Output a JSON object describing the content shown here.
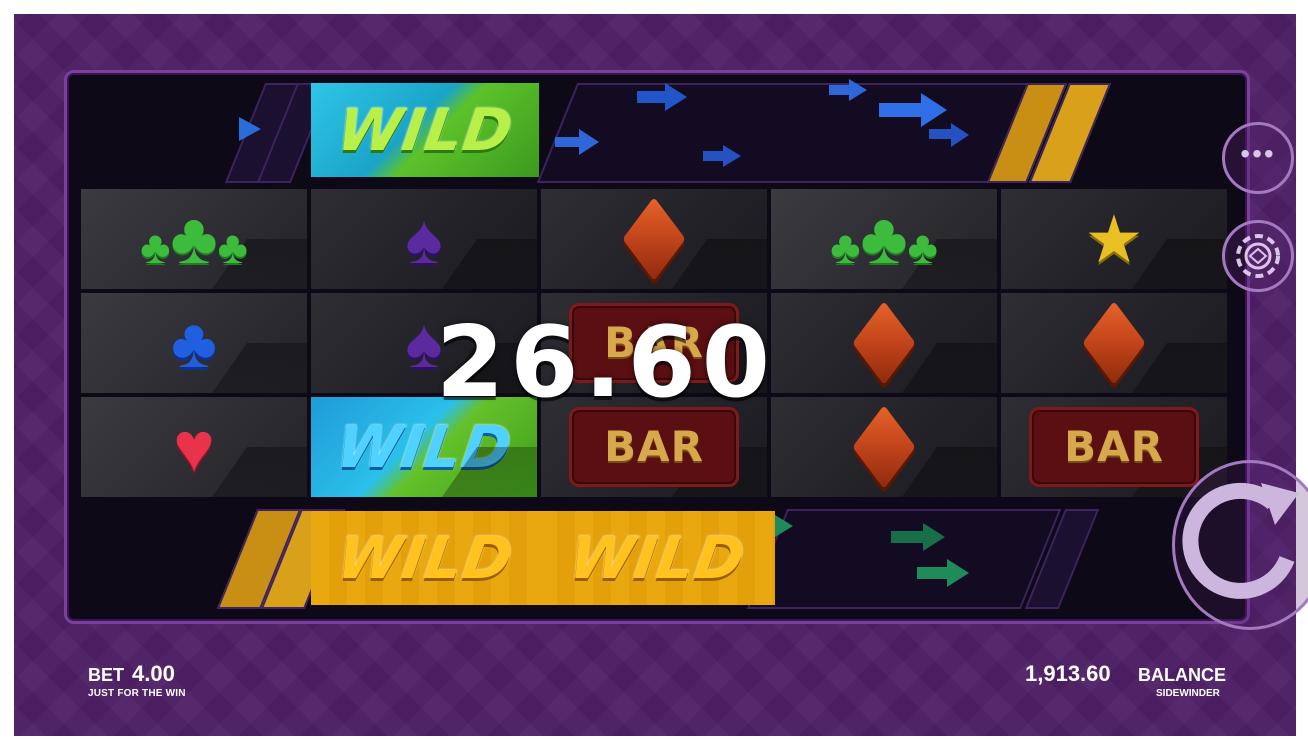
{
  "game": {
    "win_amount": "26.60",
    "bet_label": "BET",
    "bet_value": "4.00",
    "bet_sub": "JUST FOR THE WIN",
    "balance_value": "1,913.60",
    "balance_label": "BALANCE",
    "balance_sub": "SIDEWINDER"
  },
  "symbols": {
    "wild": "WILD",
    "bar": "BAR"
  },
  "colors": {
    "background": "#4f2066",
    "frame": "#7b3fa0",
    "accent": "#a37ac0"
  },
  "grid": [
    [
      "clover",
      "spade",
      "diamond",
      "clover",
      "star"
    ],
    [
      "club",
      "spade",
      "bar",
      "diamond",
      "diamond"
    ],
    [
      "heart",
      "wild",
      "bar",
      "diamond",
      "bar"
    ]
  ],
  "icons": {
    "menu": "more-dots-icon",
    "chip": "casino-chip-icon",
    "spin": "spin-arrow-icon"
  }
}
